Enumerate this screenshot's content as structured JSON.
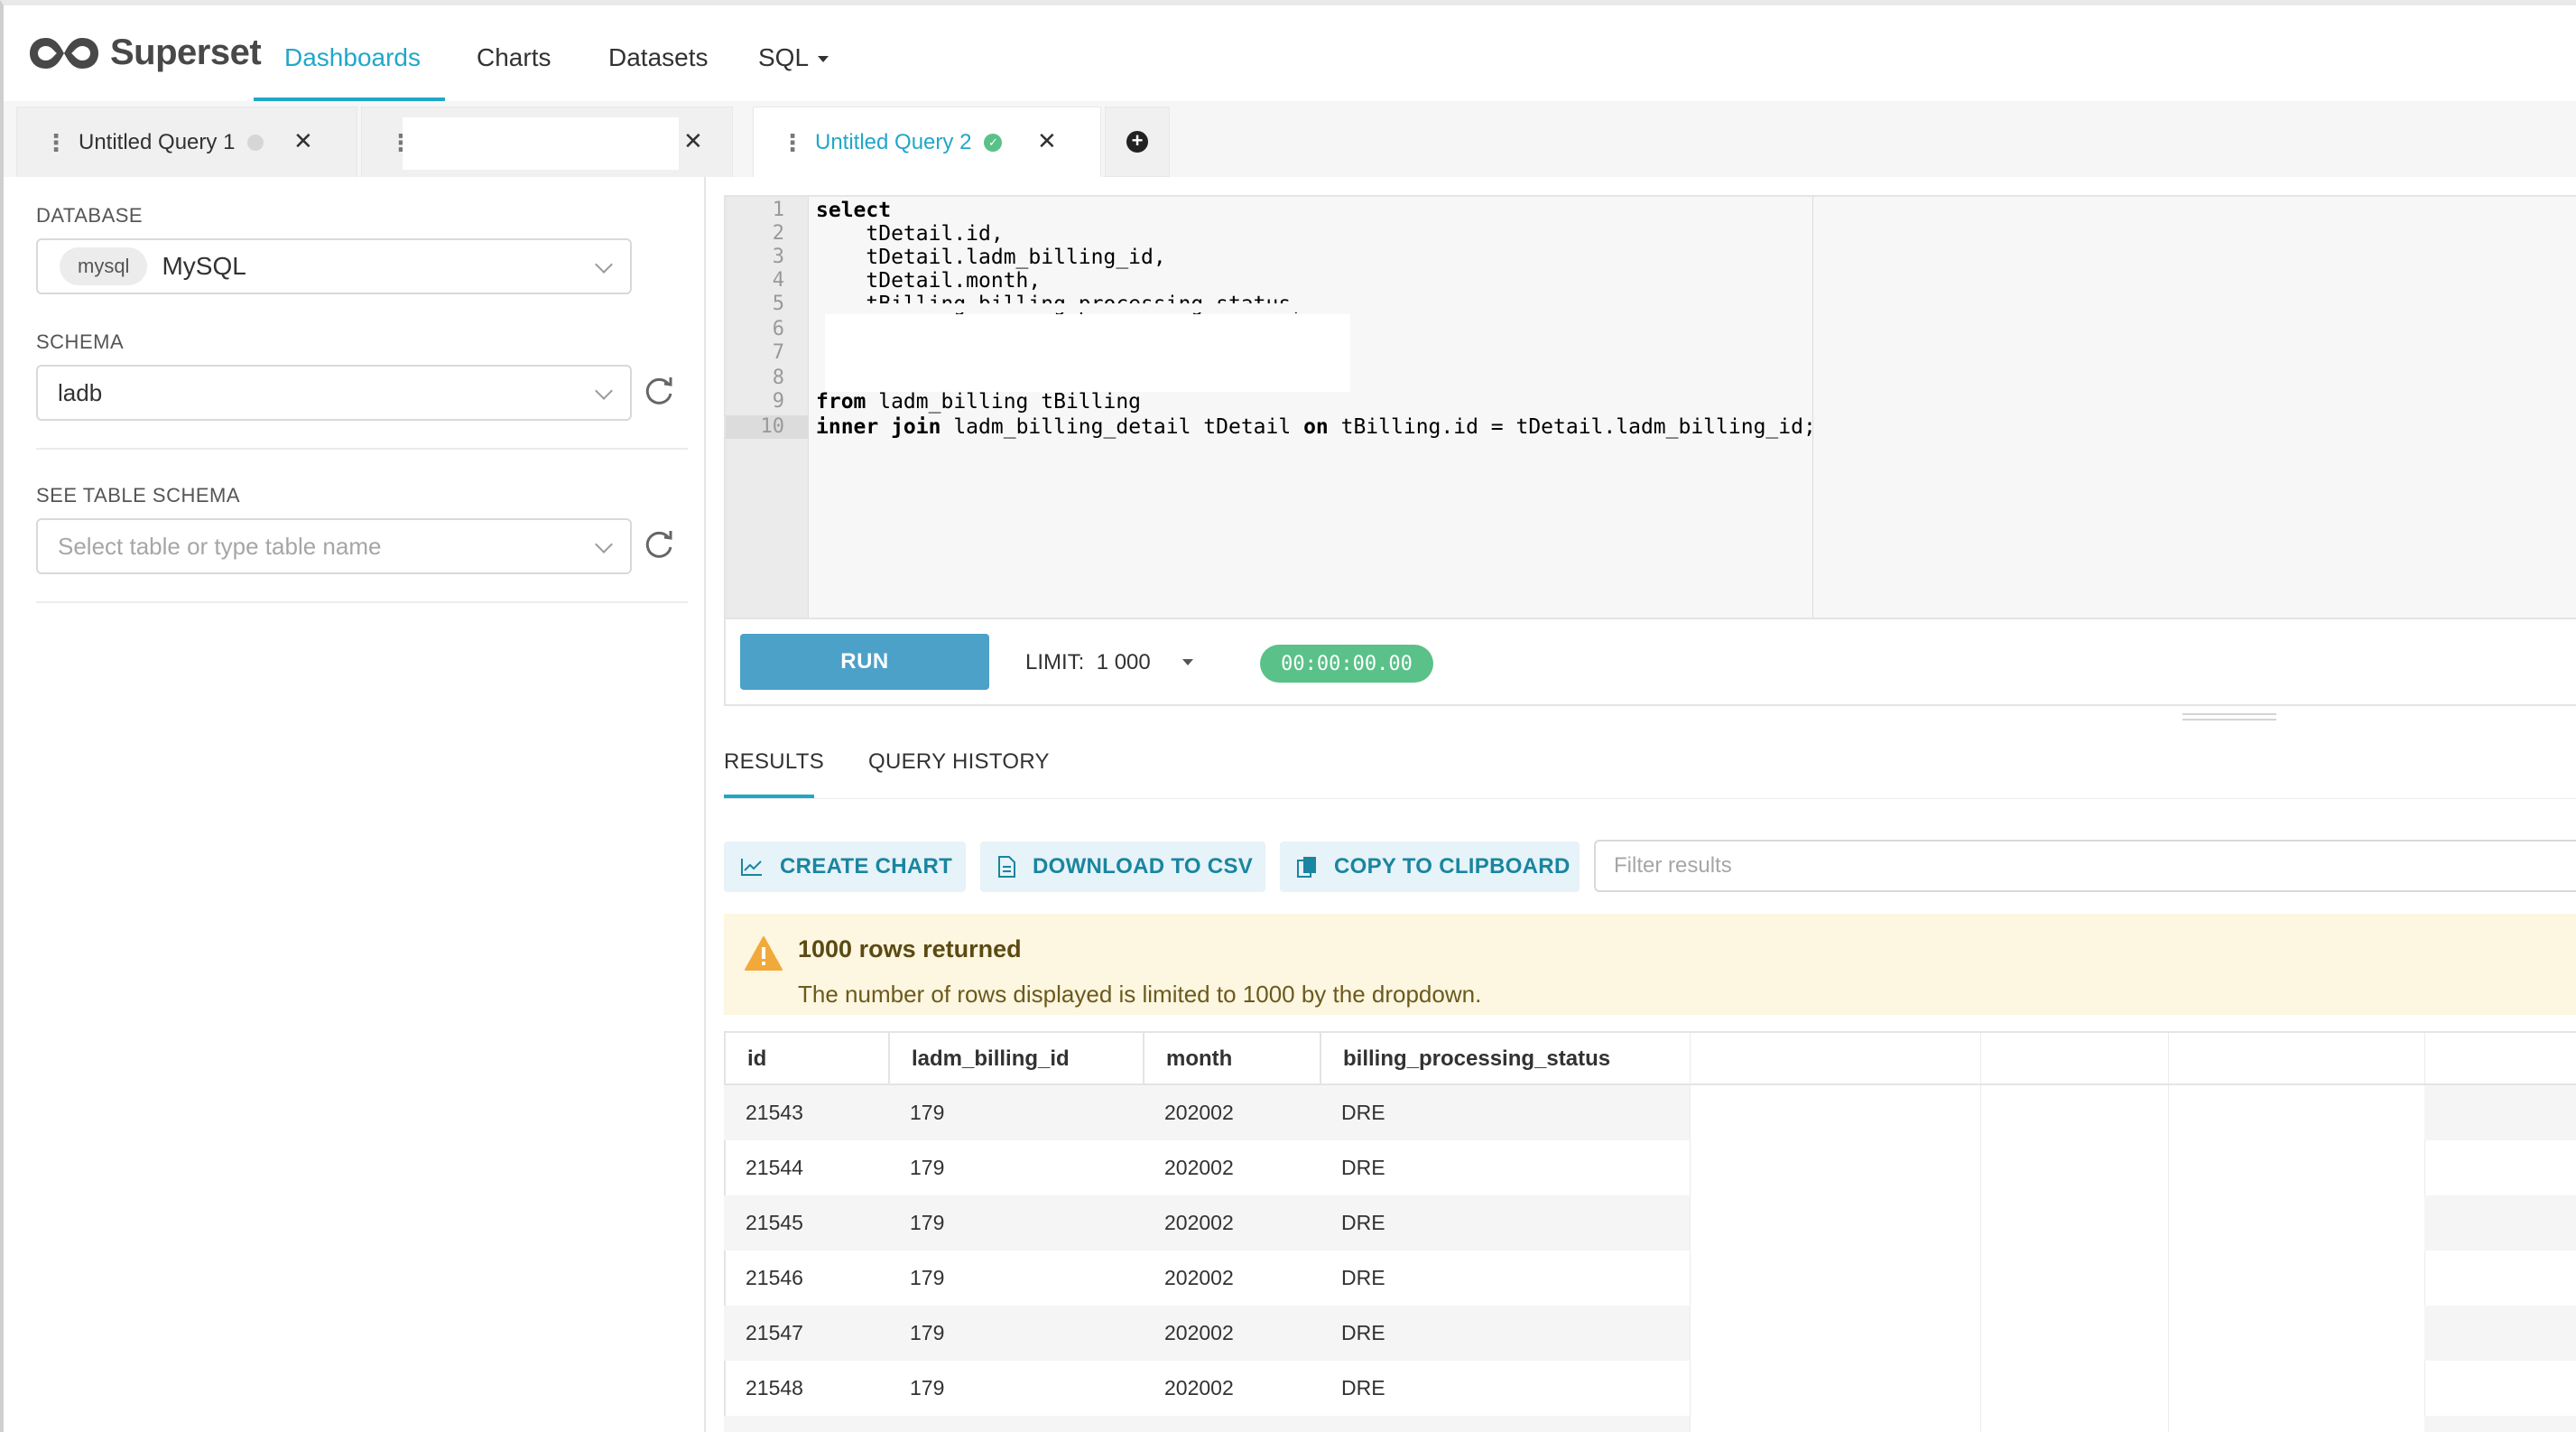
{
  "nav": {
    "brand": "Superset",
    "items": [
      {
        "label": "Dashboards",
        "active": true
      },
      {
        "label": "Charts",
        "active": false
      },
      {
        "label": "Datasets",
        "active": false
      },
      {
        "label": "SQL",
        "active": false,
        "dropdown": true
      }
    ]
  },
  "tabs": [
    {
      "label": "Untitled Query 1",
      "status": "idle",
      "active": false
    },
    {
      "label": "",
      "status": "",
      "active": false
    },
    {
      "label": "Untitled Query 2",
      "status": "success",
      "active": true
    }
  ],
  "left": {
    "database_label": "DATABASE",
    "database_tag": "mysql",
    "database_value": "MySQL",
    "schema_label": "SCHEMA",
    "schema_value": "ladb",
    "table_schema_label": "SEE TABLE SCHEMA",
    "table_placeholder": "Select table or type table name"
  },
  "editor": {
    "line_numbers": [
      "1",
      "2",
      "3",
      "4",
      "5",
      "6",
      "7",
      "8",
      "9",
      "10"
    ],
    "active_line": "10",
    "lines": [
      {
        "kw": "select",
        "rest": ""
      },
      {
        "kw": "",
        "rest": "    tDetail.id,"
      },
      {
        "kw": "",
        "rest": "    tDetail.ladm_billing_id,"
      },
      {
        "kw": "",
        "rest": "    tDetail.month,"
      },
      {
        "kw": "",
        "rest": "    tBilling.billing_processing_status,"
      },
      {
        "kw": "",
        "rest": ""
      },
      {
        "kw": "",
        "rest": ""
      },
      {
        "kw": "",
        "rest": ""
      },
      {
        "kw": "from",
        "rest": " ladm_billing tBilling"
      },
      {
        "kw": "inner join",
        "rest": " ladm_billing_detail tDetail ",
        "kw2": "on",
        "rest2": " tBilling.id = tDetail.ladm_billing_id;"
      }
    ]
  },
  "runbar": {
    "run_label": "RUN",
    "limit_label": "LIMIT:",
    "limit_value": "1 000",
    "timer": "00:00:00.00"
  },
  "results": {
    "tabs": [
      "RESULTS",
      "QUERY HISTORY"
    ],
    "active_tab": "RESULTS",
    "create_chart": "CREATE CHART",
    "download_csv": "DOWNLOAD TO CSV",
    "copy_clipboard": "COPY TO CLIPBOARD",
    "filter_placeholder": "Filter results",
    "alert_title": "1000 rows returned",
    "alert_body": "The number of rows displayed is limited to 1000 by the dropdown.",
    "columns": [
      "id",
      "ladm_billing_id",
      "month",
      "billing_processing_status"
    ],
    "rows": [
      [
        "21543",
        "179",
        "202002",
        "DRE"
      ],
      [
        "21544",
        "179",
        "202002",
        "DRE"
      ],
      [
        "21545",
        "179",
        "202002",
        "DRE"
      ],
      [
        "21546",
        "179",
        "202002",
        "DRE"
      ],
      [
        "21547",
        "179",
        "202002",
        "DRE"
      ],
      [
        "21548",
        "179",
        "202002",
        "DRE"
      ]
    ]
  },
  "colors": {
    "accent": "#20a7c9",
    "run_button": "#4ba1c8",
    "success": "#5ac189",
    "alert_bg": "#fdf6e0",
    "alert_icon": "#f2a93b"
  }
}
